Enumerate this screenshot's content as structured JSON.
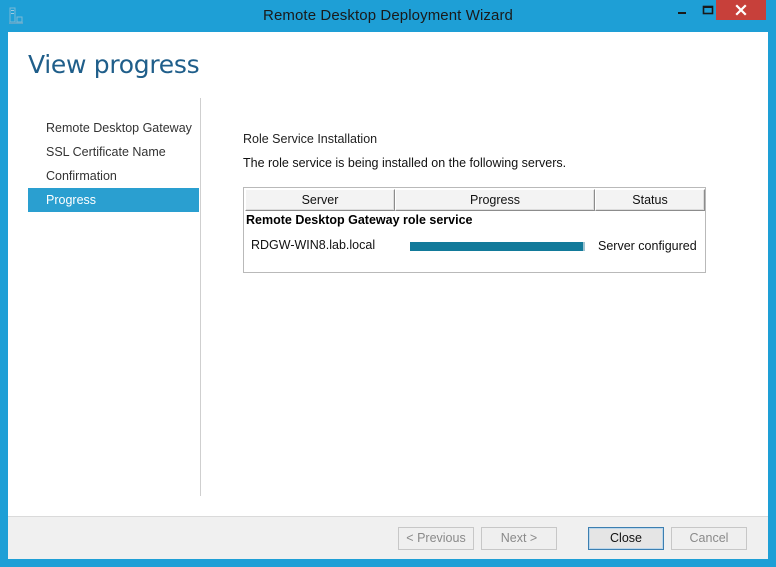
{
  "window": {
    "title": "Remote Desktop Deployment Wizard",
    "accent_color": "#1e9fd6",
    "controls": {
      "minimize_icon": "minimize-icon",
      "maximize_icon": "maximize-icon",
      "close_icon": "close-icon"
    }
  },
  "page": {
    "title": "View progress"
  },
  "nav": {
    "items": [
      {
        "label": "Remote Desktop Gateway",
        "active": false
      },
      {
        "label": "SSL Certificate Name",
        "active": false
      },
      {
        "label": "Confirmation",
        "active": false
      },
      {
        "label": "Progress",
        "active": true
      }
    ],
    "active_color": "#2a9fd0"
  },
  "main": {
    "section_title": "Role Service Installation",
    "description": "The role service is being installed on the following servers.",
    "grid": {
      "columns": [
        "Server",
        "Progress",
        "Status"
      ],
      "group_label": "Remote Desktop Gateway role service",
      "rows": [
        {
          "server": "RDGW-WIN8.lab.local",
          "progress": 1.0,
          "status": "Server configured"
        }
      ],
      "progress_color": "#127a9a"
    }
  },
  "footer": {
    "previous_label": "< Previous",
    "next_label": "Next >",
    "close_label": "Close",
    "cancel_label": "Cancel"
  }
}
